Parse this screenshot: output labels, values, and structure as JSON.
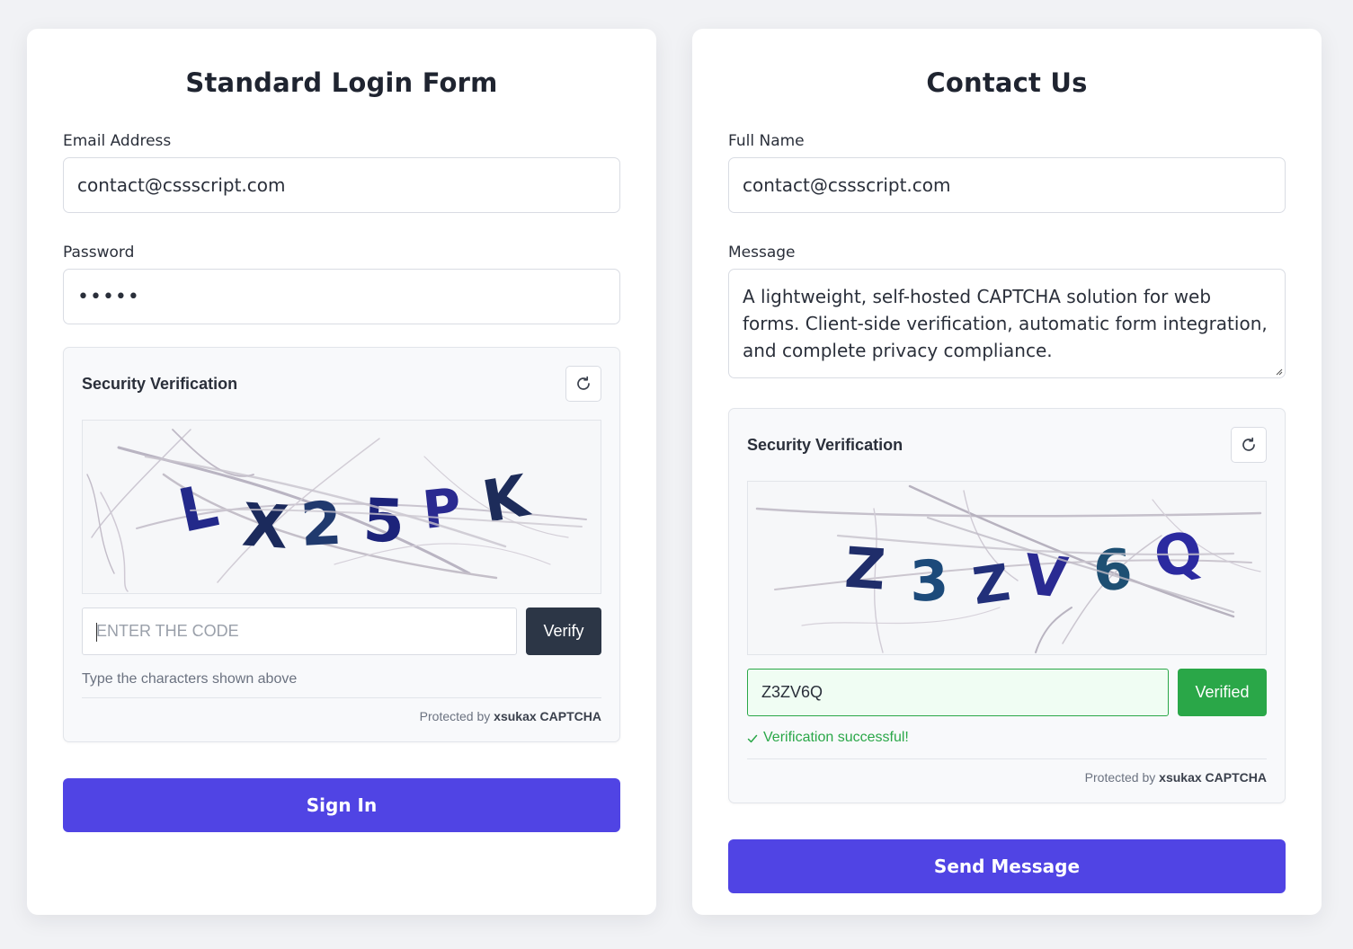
{
  "login_form": {
    "title": "Standard Login Form",
    "email_label": "Email Address",
    "email_value": "contact@cssscript.com",
    "password_label": "Password",
    "password_value": "•••••",
    "captcha": {
      "title": "Security Verification",
      "code": "LX25PK",
      "input_placeholder": "ENTER THE CODE",
      "verify_label": "Verify",
      "hint": "Type the characters shown above",
      "protected_prefix": "Protected by",
      "protected_brand": "xsukax CAPTCHA"
    },
    "submit_label": "Sign In"
  },
  "contact_form": {
    "title": "Contact Us",
    "name_label": "Full Name",
    "name_value": "contact@cssscript.com",
    "message_label": "Message",
    "message_value": "A lightweight, self-hosted CAPTCHA solution for web forms. Client-side verification, automatic form integration, and complete privacy compliance.",
    "captcha": {
      "title": "Security Verification",
      "code": "Z3ZV6Q",
      "input_value": "Z3ZV6Q",
      "verify_label": "Verified",
      "success_text": "Verification successful!",
      "protected_prefix": "Protected by",
      "protected_brand": "xsukax CAPTCHA"
    },
    "submit_label": "Send Message"
  },
  "colors": {
    "primary": "#5044e4",
    "verify_dark": "#2c3646",
    "success": "#2aa748",
    "page_bg": "#f1f2f5"
  },
  "icons": {
    "refresh": "refresh-icon",
    "check": "check-icon"
  }
}
